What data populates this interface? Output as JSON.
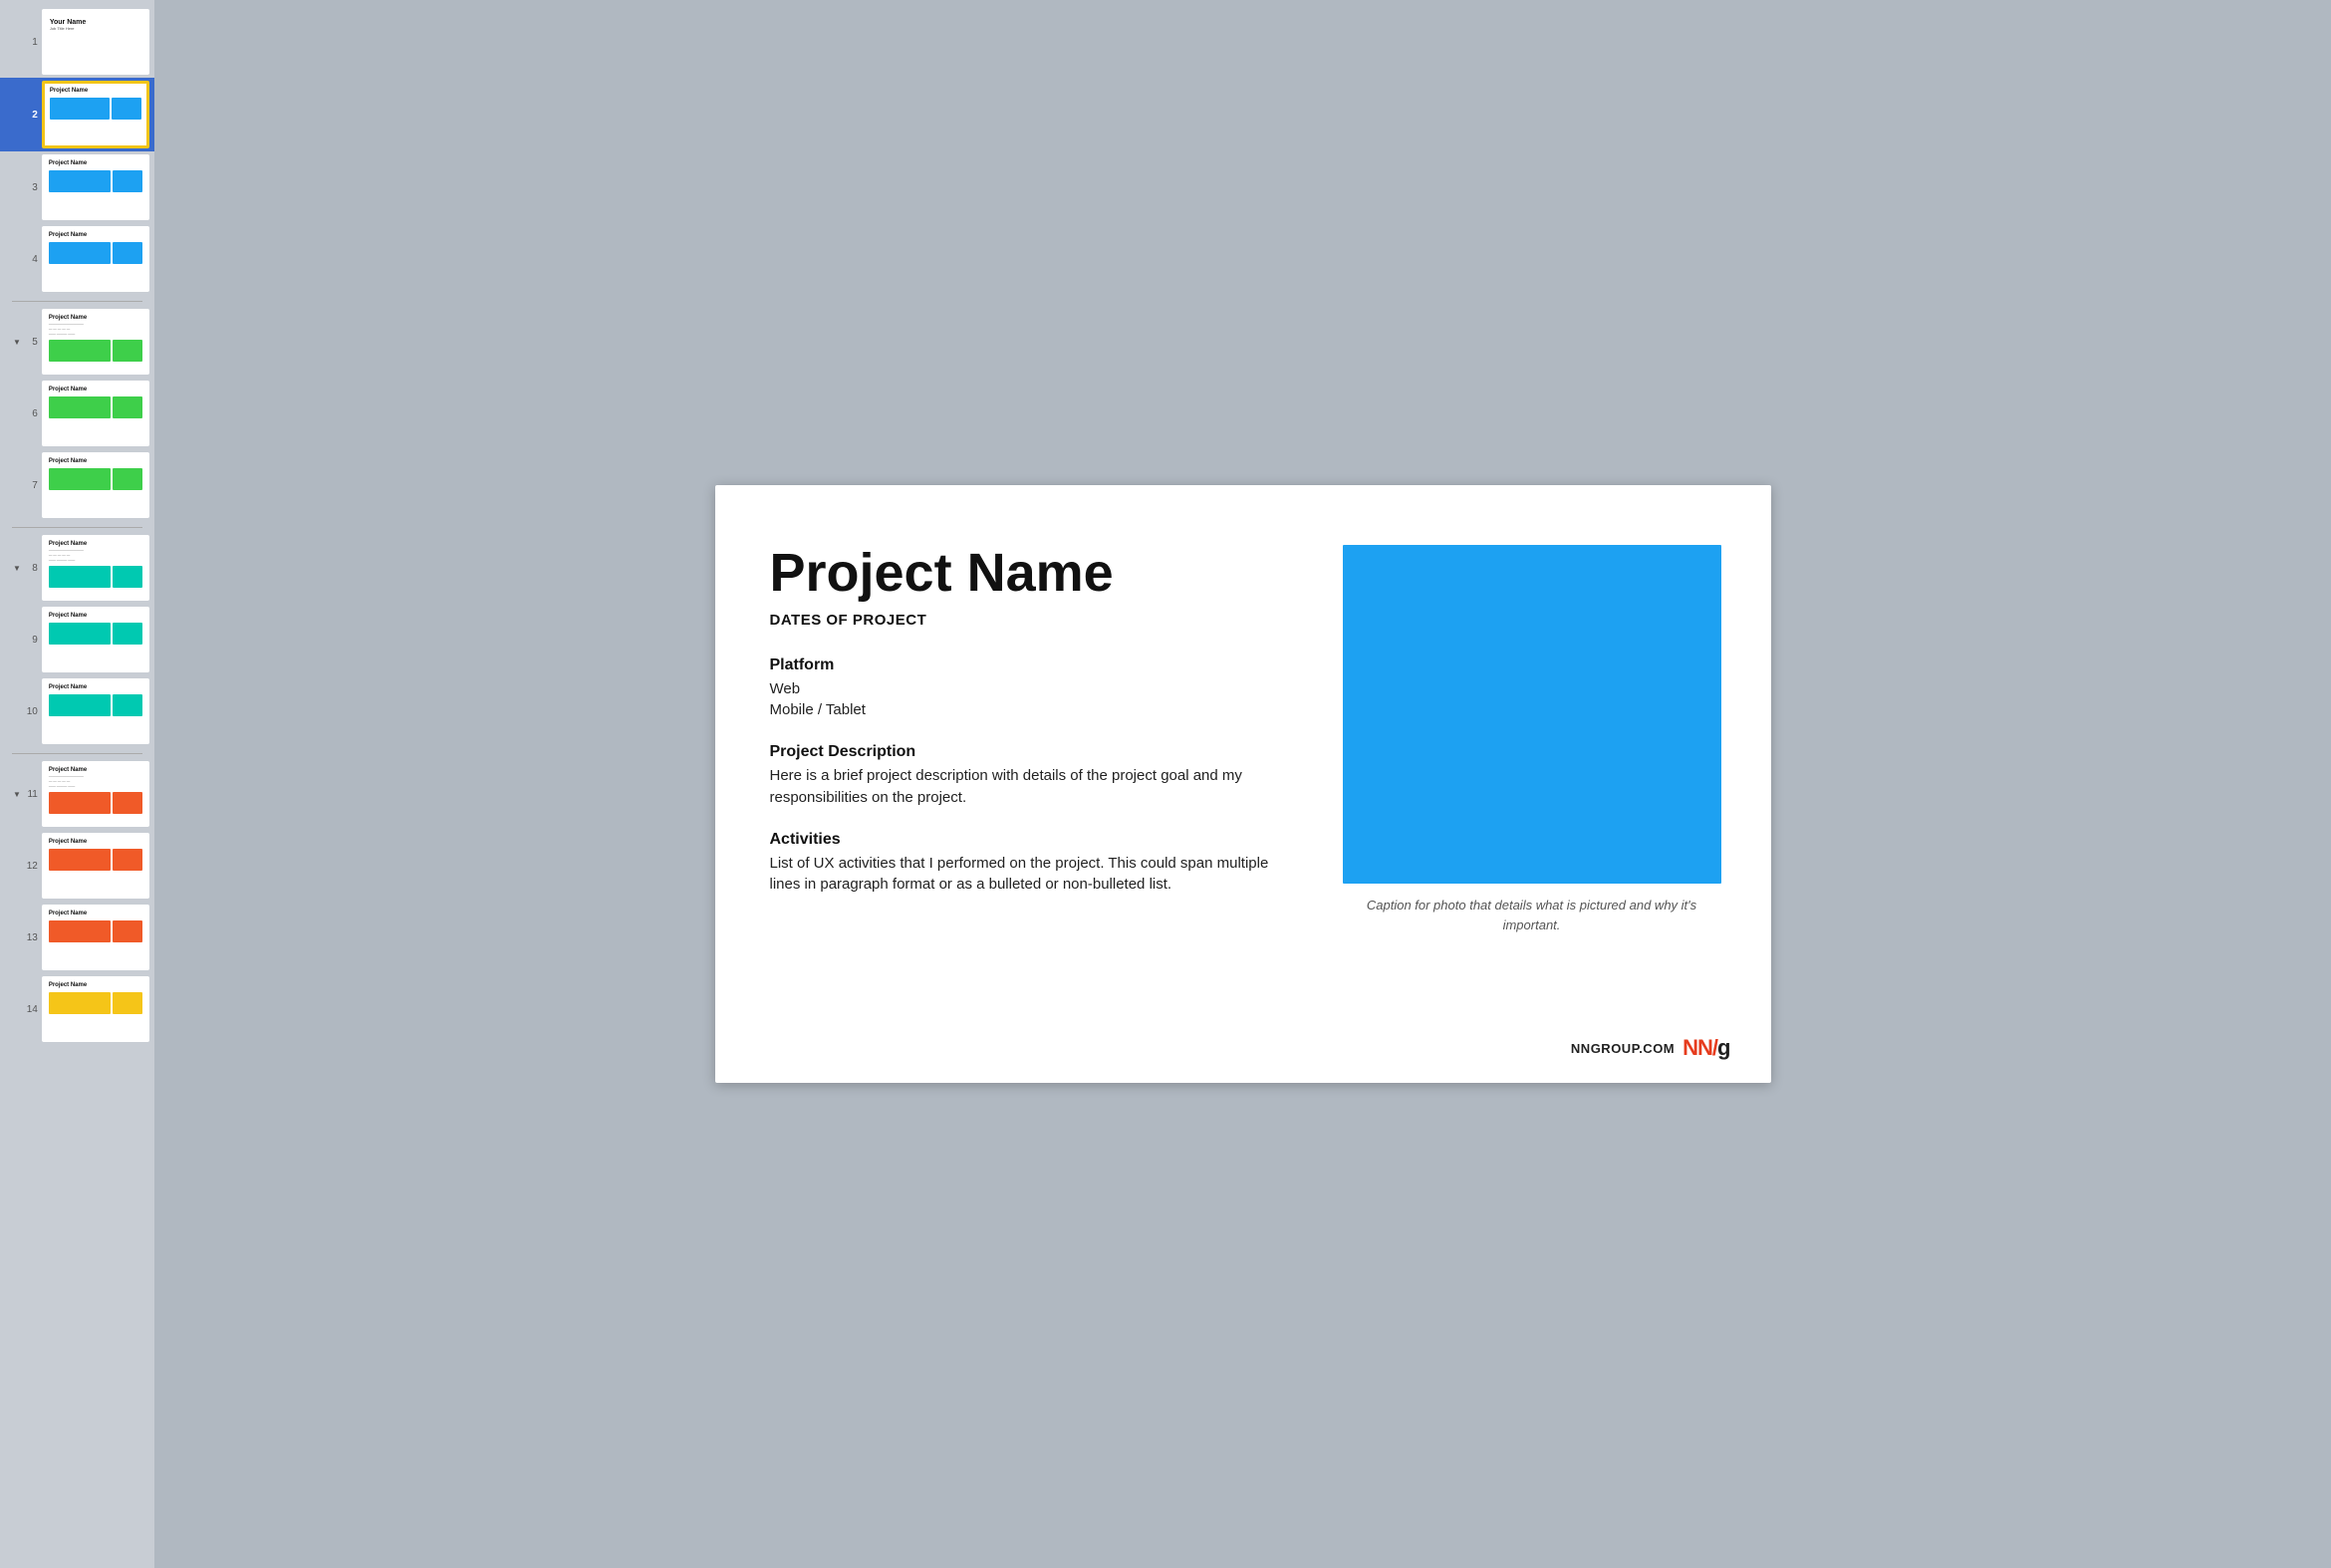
{
  "sidebar": {
    "slides": [
      {
        "num": "1",
        "type": "title",
        "selected": false,
        "hasArrow": false,
        "title": "Your Name",
        "subtitle": "Job Title Here",
        "bars": []
      },
      {
        "num": "2",
        "type": "project-blue",
        "selected": true,
        "hasArrow": false,
        "title": "Project Name",
        "subtitle": "",
        "bars": [
          {
            "color": "blue"
          },
          {
            "color": "blue"
          }
        ]
      },
      {
        "num": "3",
        "type": "project-blue",
        "selected": false,
        "hasArrow": false,
        "title": "Project Name",
        "subtitle": "",
        "bars": [
          {
            "color": "blue"
          },
          {
            "color": "blue"
          }
        ]
      },
      {
        "num": "4",
        "type": "project-blue",
        "selected": false,
        "hasArrow": false,
        "title": "Project Name",
        "subtitle": "",
        "bars": [
          {
            "color": "blue"
          },
          {
            "color": "blue"
          }
        ]
      },
      {
        "num": "5",
        "type": "project-green",
        "selected": false,
        "hasArrow": true,
        "title": "Project Name",
        "subtitle": "",
        "bars": [
          {
            "color": "green"
          },
          {
            "color": "green"
          }
        ]
      },
      {
        "num": "6",
        "type": "project-green",
        "selected": false,
        "hasArrow": false,
        "title": "Project Name",
        "subtitle": "",
        "bars": [
          {
            "color": "green"
          },
          {
            "color": "green"
          }
        ]
      },
      {
        "num": "7",
        "type": "project-green",
        "selected": false,
        "hasArrow": false,
        "title": "Project Name",
        "subtitle": "",
        "bars": [
          {
            "color": "green"
          },
          {
            "color": "green"
          }
        ]
      },
      {
        "num": "8",
        "type": "project-teal",
        "selected": false,
        "hasArrow": true,
        "title": "Project Name",
        "subtitle": "",
        "bars": [
          {
            "color": "teal"
          },
          {
            "color": "teal"
          }
        ]
      },
      {
        "num": "9",
        "type": "project-teal",
        "selected": false,
        "hasArrow": false,
        "title": "Project Name",
        "subtitle": "",
        "bars": [
          {
            "color": "teal"
          },
          {
            "color": "teal"
          }
        ]
      },
      {
        "num": "10",
        "type": "project-teal",
        "selected": false,
        "hasArrow": false,
        "title": "Project Name",
        "subtitle": "",
        "bars": [
          {
            "color": "teal"
          },
          {
            "color": "teal"
          }
        ]
      },
      {
        "num": "11",
        "type": "project-red",
        "selected": false,
        "hasArrow": true,
        "title": "Project Name",
        "subtitle": "",
        "bars": [
          {
            "color": "red"
          },
          {
            "color": "red"
          }
        ]
      },
      {
        "num": "12",
        "type": "project-red",
        "selected": false,
        "hasArrow": false,
        "title": "Project Name",
        "subtitle": "",
        "bars": [
          {
            "color": "red"
          },
          {
            "color": "red"
          }
        ]
      },
      {
        "num": "13",
        "type": "project-red",
        "selected": false,
        "hasArrow": false,
        "title": "Project Name",
        "subtitle": "",
        "bars": [
          {
            "color": "red"
          },
          {
            "color": "red"
          }
        ]
      },
      {
        "num": "14",
        "type": "project-yellow",
        "selected": false,
        "hasArrow": false,
        "title": "Project Name",
        "subtitle": "",
        "bars": [
          {
            "color": "yellow"
          },
          {
            "color": "yellow"
          }
        ]
      }
    ]
  },
  "main": {
    "project_name": "Project Name",
    "dates": "DATES OF PROJECT",
    "platform_label": "Platform",
    "platform_items": "Web\nMobile / Tablet",
    "platform_item1": "Web",
    "platform_item2": "Mobile / Tablet",
    "description_label": "Project Description",
    "description_text": "Here is a brief project description with details of the project goal and my responsibilities on the project.",
    "activities_label": "Activities",
    "activities_text": "List of UX activities that I performed on the project. This could span multiple lines in paragraph format or as a bulleted or non-bulleted list.",
    "photo_caption": "Caption for photo that details what is pictured and why it's important.",
    "photo_bg_color": "#1da1f2"
  },
  "footer": {
    "nn_group_text": "NNGROUP.COM",
    "nn_logo": "NN",
    "nn_slash": "/",
    "nn_g": "g"
  }
}
